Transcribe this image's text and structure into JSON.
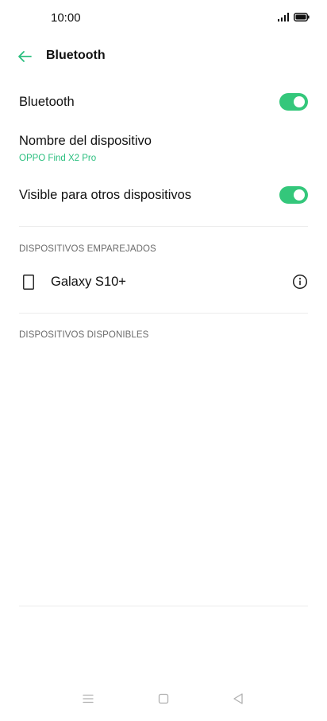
{
  "status_bar": {
    "time": "10:00",
    "signal_icon": "signal-icon",
    "battery_icon": "battery-icon"
  },
  "app_bar": {
    "title": "Bluetooth",
    "back_icon": "back-arrow-icon"
  },
  "settings": {
    "bluetooth": {
      "label": "Bluetooth",
      "enabled": true
    },
    "device_name": {
      "label": "Nombre del dispositivo",
      "value": "OPPO Find X2 Pro"
    },
    "visible": {
      "label": "Visible para otros dispositivos",
      "enabled": true
    }
  },
  "sections": {
    "paired_header": "DISPOSITIVOS EMPAREJADOS",
    "available_header": "DISPOSITIVOS DISPONIBLES"
  },
  "paired_devices": [
    {
      "name": "Galaxy S10+",
      "icon": "phone-icon",
      "action_icon": "info-icon"
    }
  ],
  "nav_bar": {
    "menu_icon": "menu-icon",
    "home_icon": "home-icon",
    "back_icon": "back-triangle-icon"
  },
  "colors": {
    "accent": "#2bbf7f",
    "toggle_on": "#34c77b"
  }
}
